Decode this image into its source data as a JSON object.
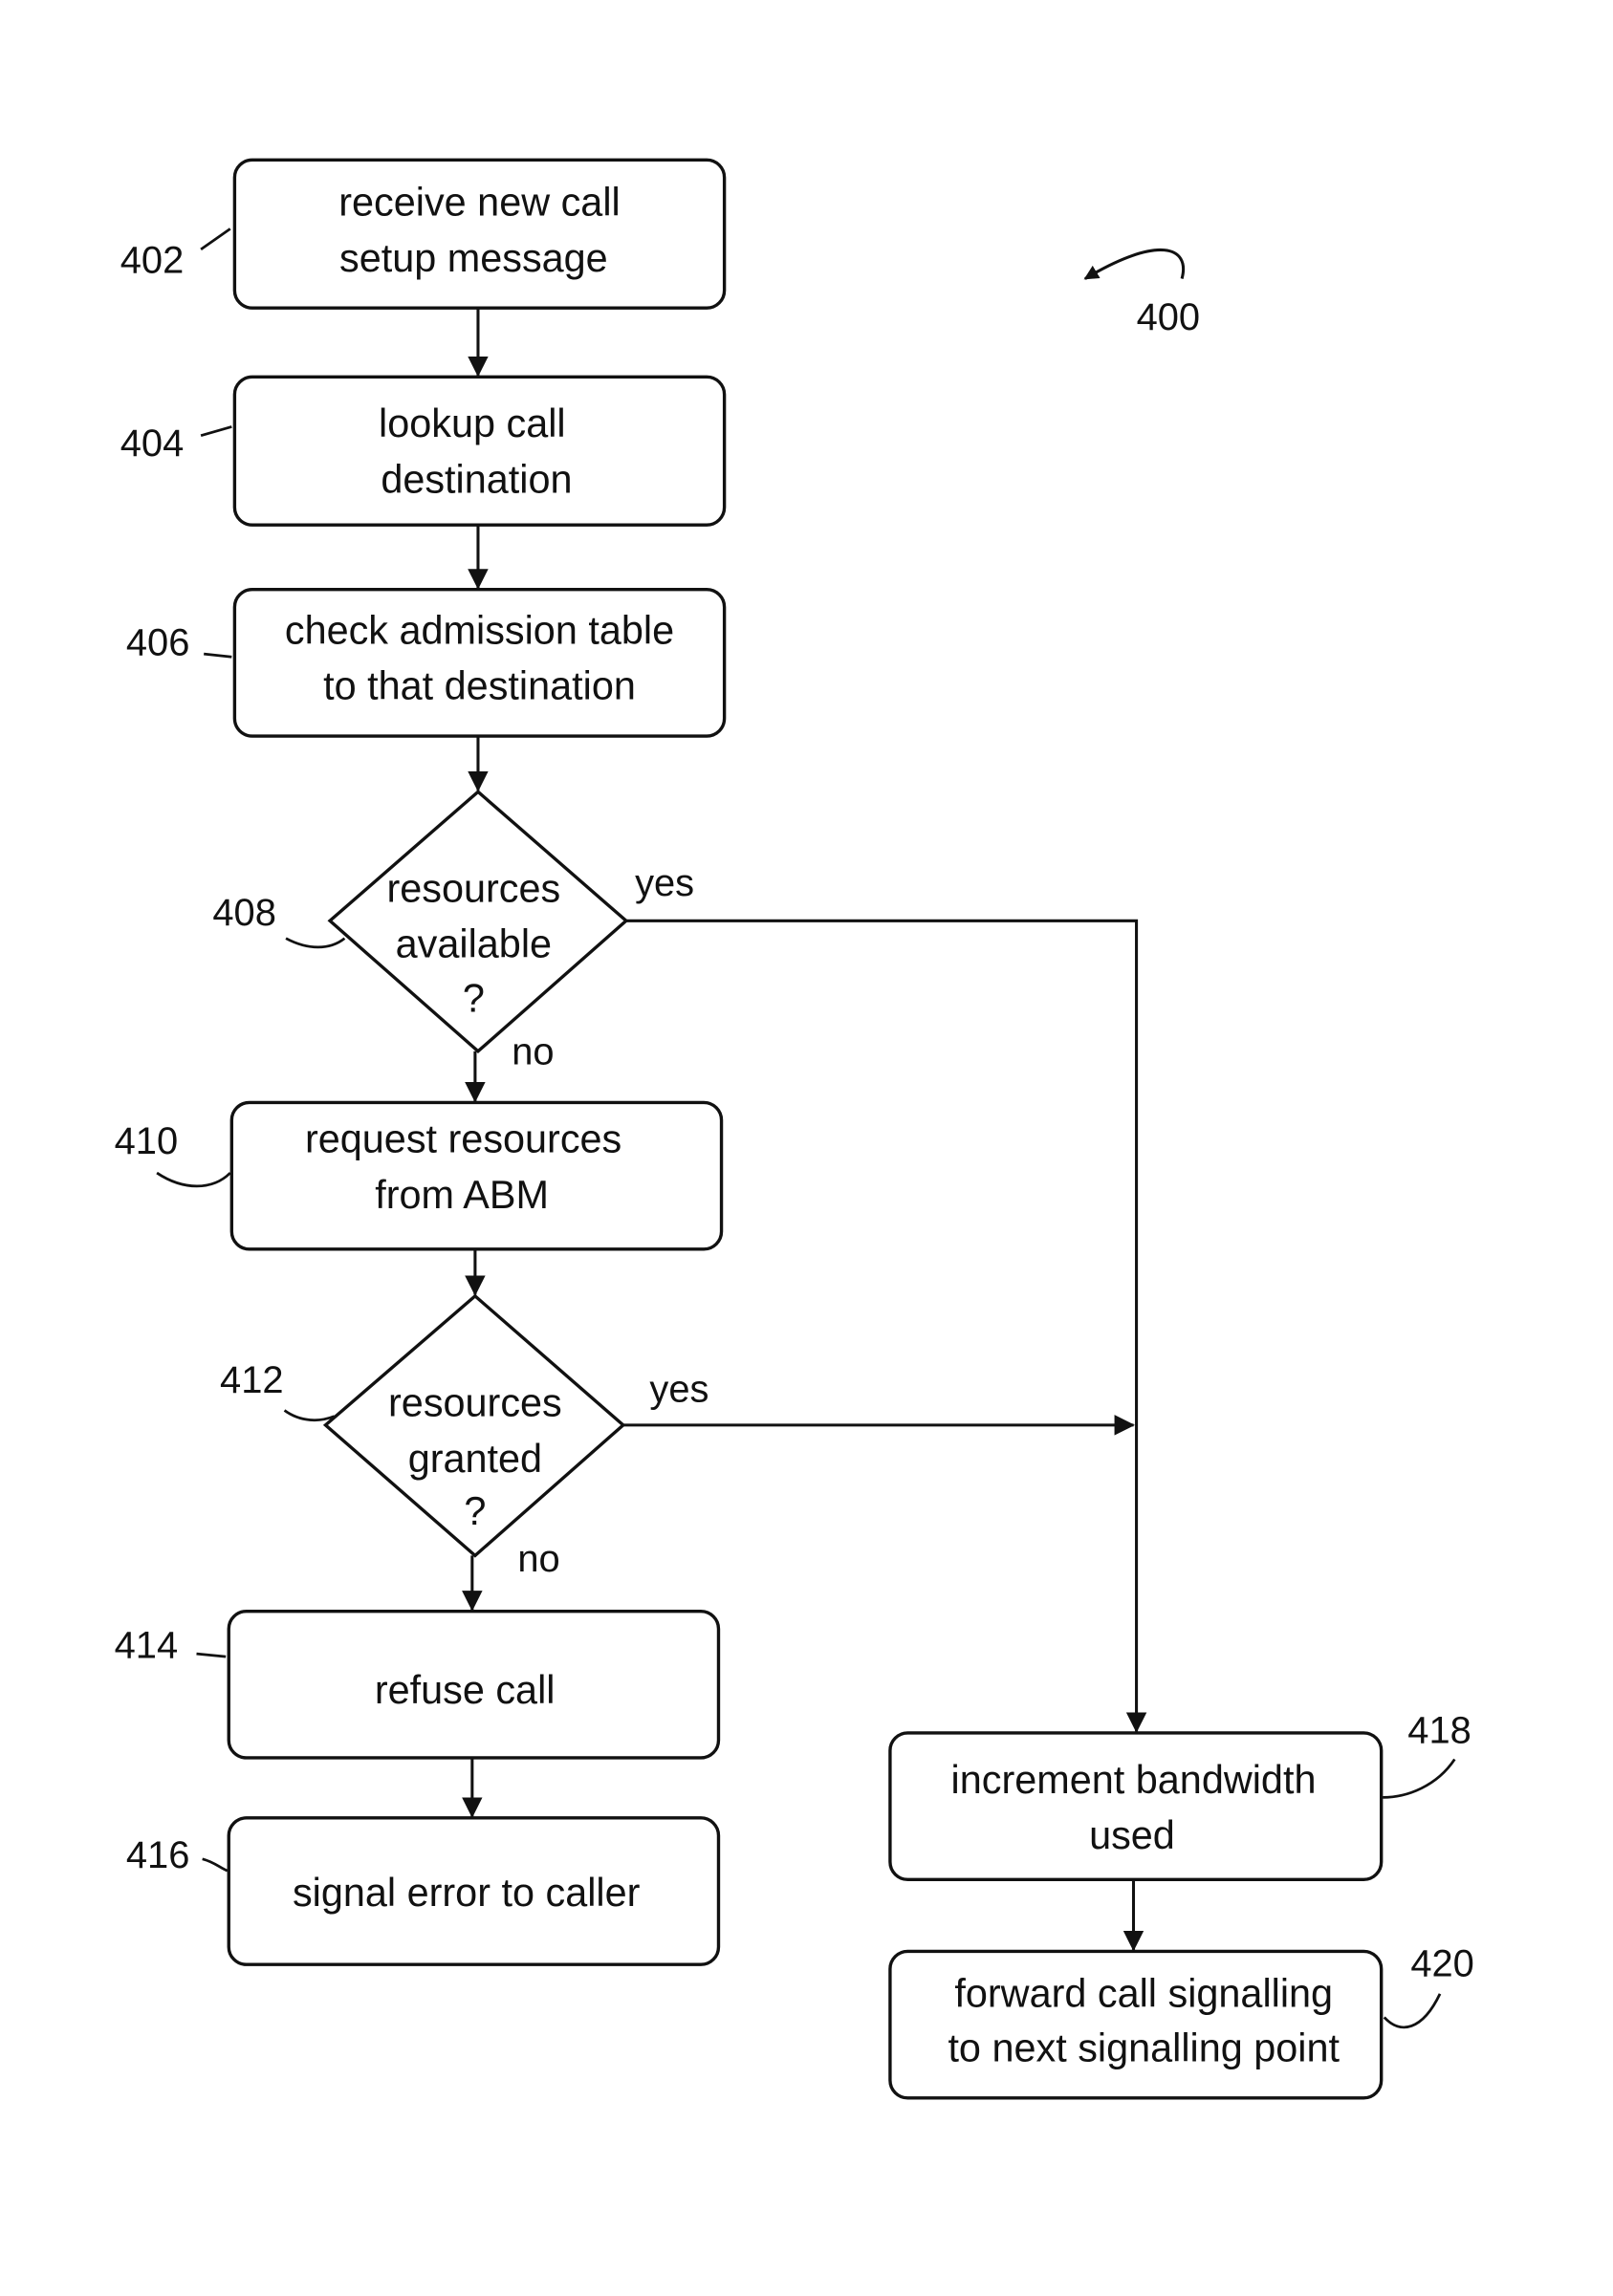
{
  "figure": {
    "ref": "400",
    "nodes": [
      {
        "ref": "402",
        "type": "process",
        "lines": [
          "receive new call",
          "setup message"
        ]
      },
      {
        "ref": "404",
        "type": "process",
        "lines": [
          "lookup call",
          "destination"
        ]
      },
      {
        "ref": "406",
        "type": "process",
        "lines": [
          "check admission table",
          "to that destination"
        ]
      },
      {
        "ref": "408",
        "type": "decision",
        "lines": [
          "resources",
          "available",
          "?"
        ]
      },
      {
        "ref": "410",
        "type": "process",
        "lines": [
          "request resources",
          "from ABM"
        ]
      },
      {
        "ref": "412",
        "type": "decision",
        "lines": [
          "resources",
          "granted",
          "?"
        ]
      },
      {
        "ref": "414",
        "type": "process",
        "lines": [
          "refuse call"
        ]
      },
      {
        "ref": "416",
        "type": "process",
        "lines": [
          "signal error to caller"
        ]
      },
      {
        "ref": "418",
        "type": "process",
        "lines": [
          "increment bandwidth",
          "used"
        ]
      },
      {
        "ref": "420",
        "type": "process",
        "lines": [
          "forward call signalling",
          "to next signalling point"
        ]
      }
    ],
    "edges": [
      {
        "from": "402",
        "to": "404",
        "label": ""
      },
      {
        "from": "404",
        "to": "406",
        "label": ""
      },
      {
        "from": "406",
        "to": "408",
        "label": ""
      },
      {
        "from": "408",
        "to": "418",
        "label": "yes"
      },
      {
        "from": "408",
        "to": "410",
        "label": "no"
      },
      {
        "from": "410",
        "to": "412",
        "label": ""
      },
      {
        "from": "412",
        "to": "418",
        "label": "yes"
      },
      {
        "from": "412",
        "to": "414",
        "label": "no"
      },
      {
        "from": "414",
        "to": "416",
        "label": ""
      },
      {
        "from": "418",
        "to": "420",
        "label": ""
      }
    ]
  }
}
